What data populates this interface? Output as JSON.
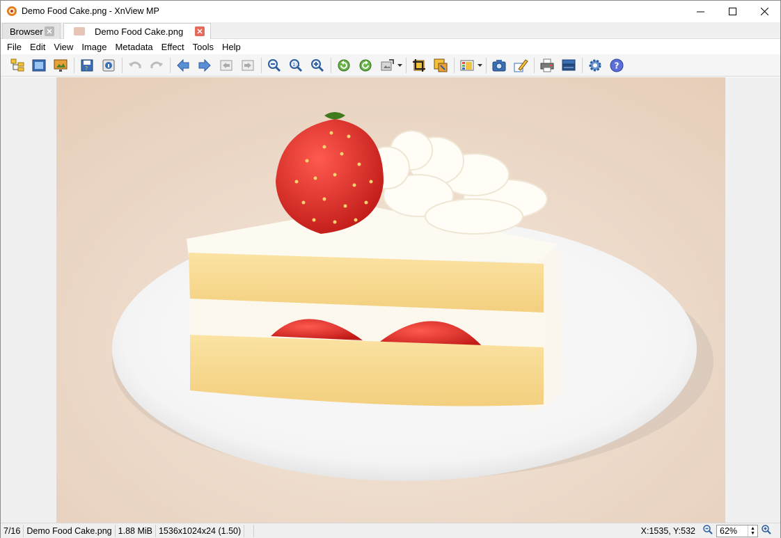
{
  "window": {
    "title": "Demo Food Cake.png - XnView MP"
  },
  "tabs": [
    {
      "label": "Browser",
      "active": false
    },
    {
      "label": "Demo Food Cake.png",
      "active": true
    }
  ],
  "menu": [
    "File",
    "Edit",
    "View",
    "Image",
    "Metadata",
    "Effect",
    "Tools",
    "Help"
  ],
  "toolbar": {
    "buttons": [
      "browser-icon",
      "fullscreen-icon",
      "slideshow-icon",
      "save-icon",
      "properties-icon",
      "undo-icon",
      "redo-icon",
      "previous-icon",
      "next-icon",
      "first-icon",
      "last-icon",
      "zoom-out-icon",
      "zoom-fit-icon",
      "zoom-in-icon",
      "rotate-left-icon",
      "rotate-right-icon",
      "transform-icon",
      "crop-icon",
      "resize-icon",
      "adjust-icon",
      "capture-icon",
      "edit-icon",
      "print-icon",
      "scan-icon",
      "settings-icon",
      "help-icon"
    ]
  },
  "status": {
    "index": "7/16",
    "filename": "Demo Food Cake.png",
    "filesize": "1.88 MiB",
    "dimensions": "1536x1024x24 (1.50)",
    "coords": "X:1535, Y:532",
    "zoom": "62%"
  },
  "colors": {
    "accent": "#e46a5a",
    "image_bg": "#ecd8c7"
  }
}
